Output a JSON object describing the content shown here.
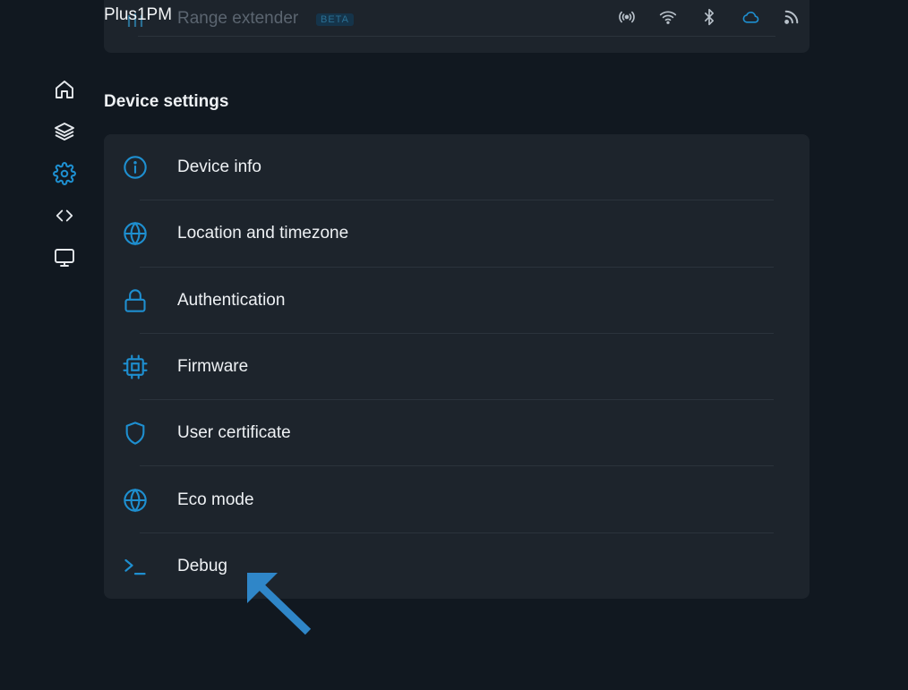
{
  "header": {
    "device_name": "Plus1PM"
  },
  "status_icons": [
    "radio-broadcast-icon",
    "wifi-icon",
    "bluetooth-icon",
    "cloud-icon",
    "rss-icon"
  ],
  "top_card": {
    "range_extender_label": "Range extender",
    "beta_badge": "BETA"
  },
  "sidebar": {
    "items": [
      "home-icon",
      "layers-icon",
      "gear-icon",
      "code-icon",
      "monitor-icon"
    ],
    "active": "gear-icon"
  },
  "section": {
    "title": "Device settings"
  },
  "settings": {
    "items": [
      {
        "label": "Device info",
        "icon": "info-icon"
      },
      {
        "label": "Location and timezone",
        "icon": "globe-icon"
      },
      {
        "label": "Authentication",
        "icon": "lock-icon"
      },
      {
        "label": "Firmware",
        "icon": "chip-icon"
      },
      {
        "label": "User certificate",
        "icon": "shield-icon"
      },
      {
        "label": "Eco mode",
        "icon": "globe-icon"
      },
      {
        "label": "Debug",
        "icon": "terminal-icon"
      }
    ]
  },
  "colors": {
    "background": "#111820",
    "card": "#1d242c",
    "accent": "#1e8fd0",
    "annotation_arrow": "#2f86c8"
  }
}
